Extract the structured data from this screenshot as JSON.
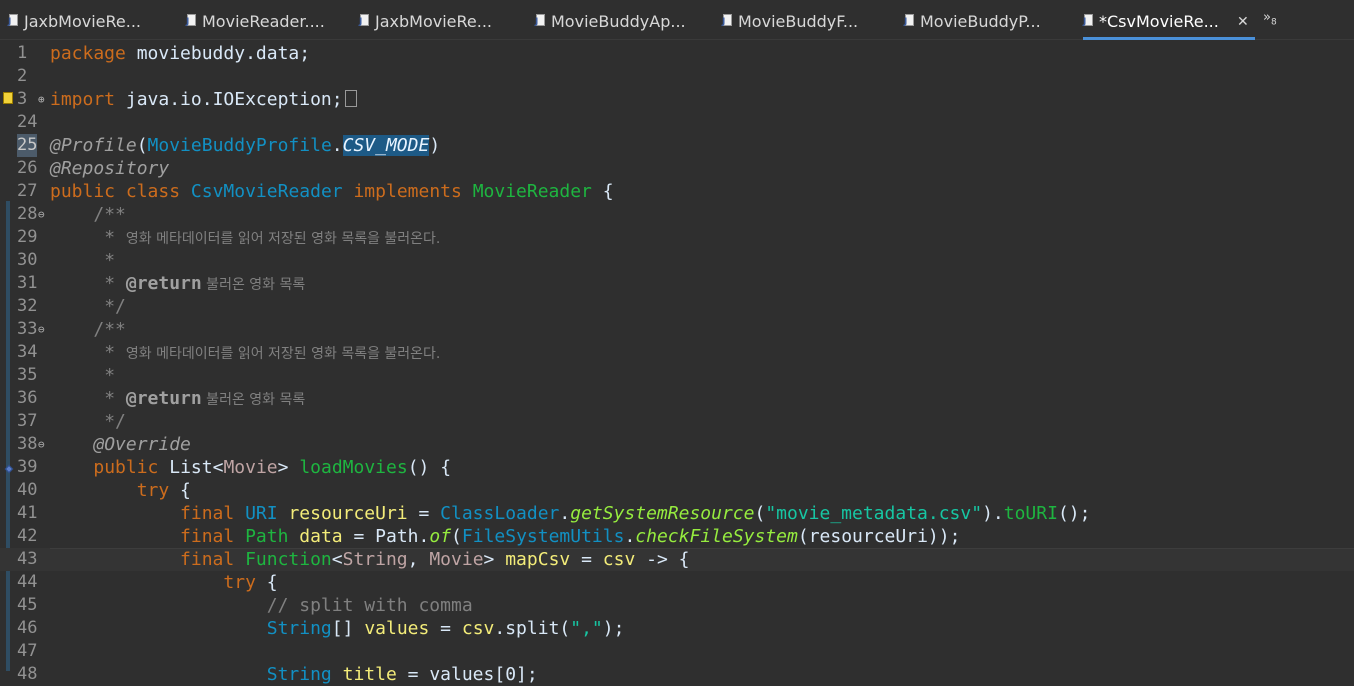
{
  "tabs": [
    {
      "label": "JaxbMovieRe...",
      "active": false
    },
    {
      "label": "MovieReader....",
      "active": false
    },
    {
      "label": "JaxbMovieRe...",
      "active": false
    },
    {
      "label": "MovieBuddyAp...",
      "active": false
    },
    {
      "label": "MovieBuddyF...",
      "active": false
    },
    {
      "label": "MovieBuddyP...",
      "active": false
    },
    {
      "label": "*CsvMovieRe...",
      "active": true
    }
  ],
  "tab_close": "✕",
  "tab_more": "»",
  "tab_more_count": "8",
  "line_numbers": [
    "1",
    "2",
    "3",
    "24",
    "25",
    "26",
    "27",
    "28",
    "29",
    "30",
    "31",
    "32",
    "33",
    "34",
    "35",
    "36",
    "37",
    "38",
    "39",
    "40",
    "41",
    "42",
    "43",
    "44",
    "45",
    "46",
    "47",
    "48"
  ],
  "code": {
    "l1": {
      "kw": "package",
      "rest": " moviebuddy.data;"
    },
    "l3": {
      "kw": "import",
      "rest": " java.io.IOException;"
    },
    "l25": {
      "ann": "@Profile",
      "p1": "(",
      "cls": "MovieBuddyProfile",
      "dot": ".",
      "field": "CSV_MODE",
      "p2": ")"
    },
    "l26": {
      "ann": "@Repository"
    },
    "l27": {
      "kw1": "public",
      "kw2": "class",
      "cls": "CsvMovieReader",
      "kw3": "implements",
      "iface": "MovieReader",
      "brace": " {"
    },
    "l28": {
      "text": "/**"
    },
    "l29": {
      "star": " * ",
      "text": "영화 메타데이터를 읽어 저장된 영화 목록을 불러온다."
    },
    "l30": {
      "text": " *"
    },
    "l31": {
      "star": " * ",
      "tag": "@return",
      "text": " 불러온 영화 목록"
    },
    "l32": {
      "text": " */"
    },
    "l33": {
      "text": "/**"
    },
    "l34": {
      "star": " * ",
      "text": "영화 메타데이터를 읽어 저장된 영화 목록을 불러온다."
    },
    "l35": {
      "text": " *"
    },
    "l36": {
      "star": " * ",
      "tag": "@return",
      "text": " 불러온 영화 목록"
    },
    "l37": {
      "text": " */"
    },
    "l38": {
      "ann": "@Override"
    },
    "l39": {
      "kw": "public",
      "type": "List",
      "lt": "<",
      "tparam": "Movie",
      "gt": ">",
      "meth": "loadMovies",
      "rest": "() {"
    },
    "l40": {
      "kw": "try",
      "rest": " {"
    },
    "l41": {
      "kw": "final",
      "type": "URI",
      "var": "resourceUri",
      "eq": " = ",
      "cls": "ClassLoader",
      "dot": ".",
      "smeth": "getSystemResource",
      "p1": "(",
      "str": "\"movie_metadata.csv\"",
      "p2": ").",
      "meth": "toURI",
      "end": "();"
    },
    "l42": {
      "kw": "final",
      "type": "Path",
      "var": "data",
      "eq": " = ",
      "cls": "Path",
      "dot": ".",
      "smeth": "of",
      "p1": "(",
      "cls2": "FileSystemUtils",
      "dot2": ".",
      "smeth2": "checkFileSystem",
      "p2": "(",
      "arg": "resourceUri",
      "end": "));"
    },
    "l43": {
      "kw": "final",
      "type": "Function",
      "lt": "<",
      "t1": "String",
      "comma": ", ",
      "t2": "Movie",
      "gt": ">",
      "var": "mapCsv",
      "eq": " = ",
      "param": "csv",
      "arrow": " -> {"
    },
    "l44": {
      "kw": "try",
      "rest": " {"
    },
    "l45": {
      "cmt": "// split with comma"
    },
    "l46": {
      "type": "String",
      "arr": "[]",
      "var": "values",
      "eq": " = ",
      "obj": "csv",
      "dot": ".",
      "meth": "split",
      "p1": "(",
      "str": "\",\"",
      "end": ");"
    },
    "l48": {
      "type": "String",
      "var": "title",
      "eq": " = ",
      "obj": "values",
      "rest": "[0];"
    }
  }
}
